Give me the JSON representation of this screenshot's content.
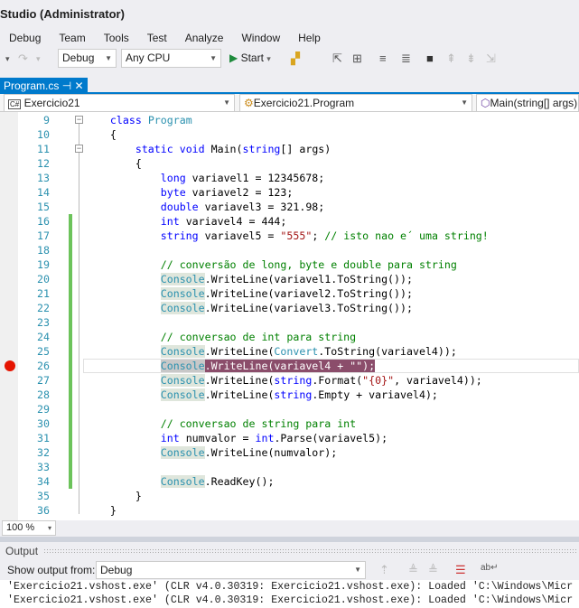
{
  "window": {
    "title": "Studio (Administrator)"
  },
  "menu": [
    "Debug",
    "Team",
    "Tools",
    "Test",
    "Analyze",
    "Window",
    "Help"
  ],
  "toolbar": {
    "configuration": "Debug",
    "platform": "Any CPU",
    "start_label": "Start"
  },
  "tab": {
    "label": "Program.cs",
    "pin": "⊣",
    "close": "✕"
  },
  "nav": {
    "project": "Exercicio21",
    "type": "Exercicio21.Program",
    "member": "Main(string[] args)",
    "project_icon": "C#"
  },
  "editor": {
    "breakpoint_line": 26,
    "lines": [
      {
        "n": "9",
        "seg": [
          [
            "    ",
            "tx"
          ],
          [
            "class",
            "kw"
          ],
          [
            " ",
            "tx"
          ],
          [
            "Program",
            "ty"
          ]
        ]
      },
      {
        "n": "10",
        "seg": [
          [
            "    {",
            "tx"
          ]
        ]
      },
      {
        "n": "11",
        "seg": [
          [
            "        ",
            "tx"
          ],
          [
            "static",
            "kw"
          ],
          [
            " ",
            "tx"
          ],
          [
            "void",
            "kw"
          ],
          [
            " Main(",
            "tx"
          ],
          [
            "string",
            "kw"
          ],
          [
            "[] args)",
            "tx"
          ]
        ]
      },
      {
        "n": "12",
        "seg": [
          [
            "        {",
            "tx"
          ]
        ]
      },
      {
        "n": "13",
        "seg": [
          [
            "            ",
            "tx"
          ],
          [
            "long",
            "kw"
          ],
          [
            " variavel1 = 12345678;",
            "tx"
          ]
        ]
      },
      {
        "n": "14",
        "seg": [
          [
            "            ",
            "tx"
          ],
          [
            "byte",
            "kw"
          ],
          [
            " variavel2 = 123;",
            "tx"
          ]
        ]
      },
      {
        "n": "15",
        "seg": [
          [
            "            ",
            "tx"
          ],
          [
            "double",
            "kw"
          ],
          [
            " variavel3 = 321.98;",
            "tx"
          ]
        ]
      },
      {
        "n": "16",
        "seg": [
          [
            "            ",
            "tx"
          ],
          [
            "int",
            "kw"
          ],
          [
            " variavel4 = 444;",
            "tx"
          ]
        ]
      },
      {
        "n": "17",
        "seg": [
          [
            "            ",
            "tx"
          ],
          [
            "string",
            "kw"
          ],
          [
            " variavel5 = ",
            "tx"
          ],
          [
            "\"555\"",
            "st"
          ],
          [
            "; ",
            "tx"
          ],
          [
            "// isto nao e´ uma string!",
            "cm"
          ]
        ]
      },
      {
        "n": "18",
        "seg": []
      },
      {
        "n": "19",
        "seg": [
          [
            "            ",
            "tx"
          ],
          [
            "// conversão de long, byte e double para string",
            "cm"
          ]
        ]
      },
      {
        "n": "20",
        "seg": [
          [
            "            ",
            "tx"
          ],
          [
            "Console",
            "ref"
          ],
          [
            ".WriteLine(variavel1.ToString());",
            "tx"
          ]
        ]
      },
      {
        "n": "21",
        "seg": [
          [
            "            ",
            "tx"
          ],
          [
            "Console",
            "ref"
          ],
          [
            ".WriteLine(variavel2.ToString());",
            "tx"
          ]
        ]
      },
      {
        "n": "22",
        "seg": [
          [
            "            ",
            "tx"
          ],
          [
            "Console",
            "ref"
          ],
          [
            ".WriteLine(variavel3.ToString());",
            "tx"
          ]
        ]
      },
      {
        "n": "23",
        "seg": []
      },
      {
        "n": "24",
        "seg": [
          [
            "            ",
            "tx"
          ],
          [
            "// conversao de int para string",
            "cm"
          ]
        ]
      },
      {
        "n": "25",
        "seg": [
          [
            "            ",
            "tx"
          ],
          [
            "Console",
            "ref"
          ],
          [
            ".WriteLine(",
            "tx"
          ],
          [
            "Convert",
            "ty"
          ],
          [
            ".ToString(variavel4));",
            "tx"
          ]
        ]
      },
      {
        "n": "26",
        "seg": [
          [
            "            ",
            "tx"
          ],
          [
            "Console",
            "selref"
          ],
          [
            ".WriteLine(variavel4 + \"\");",
            "sel"
          ]
        ]
      },
      {
        "n": "27",
        "seg": [
          [
            "            ",
            "tx"
          ],
          [
            "Console",
            "ref"
          ],
          [
            ".WriteLine(",
            "tx"
          ],
          [
            "string",
            "kw"
          ],
          [
            ".Format(",
            "tx"
          ],
          [
            "\"{0}\"",
            "st"
          ],
          [
            ", variavel4));",
            "tx"
          ]
        ]
      },
      {
        "n": "28",
        "seg": [
          [
            "            ",
            "tx"
          ],
          [
            "Console",
            "ref"
          ],
          [
            ".WriteLine(",
            "tx"
          ],
          [
            "string",
            "kw"
          ],
          [
            ".Empty + variavel4);",
            "tx"
          ]
        ]
      },
      {
        "n": "29",
        "seg": []
      },
      {
        "n": "30",
        "seg": [
          [
            "            ",
            "tx"
          ],
          [
            "// conversao de string para int",
            "cm"
          ]
        ]
      },
      {
        "n": "31",
        "seg": [
          [
            "            ",
            "tx"
          ],
          [
            "int",
            "kw"
          ],
          [
            " numvalor = ",
            "tx"
          ],
          [
            "int",
            "kw"
          ],
          [
            ".Parse(variavel5);",
            "tx"
          ]
        ]
      },
      {
        "n": "32",
        "seg": [
          [
            "            ",
            "tx"
          ],
          [
            "Console",
            "ref"
          ],
          [
            ".WriteLine(numvalor);",
            "tx"
          ]
        ]
      },
      {
        "n": "33",
        "seg": []
      },
      {
        "n": "34",
        "seg": [
          [
            "            ",
            "tx"
          ],
          [
            "Console",
            "ref"
          ],
          [
            ".ReadKey();",
            "tx"
          ]
        ]
      },
      {
        "n": "35",
        "seg": [
          [
            "        }",
            "tx"
          ]
        ]
      },
      {
        "n": "36",
        "seg": [
          [
            "    }",
            "tx"
          ]
        ]
      }
    ]
  },
  "zoom": {
    "value": "100 %"
  },
  "output": {
    "title": "Output",
    "show_from_label": "Show output from:",
    "source": "Debug",
    "lines": [
      "'Exercicio21.vshost.exe' (CLR v4.0.30319: Exercicio21.vshost.exe): Loaded 'C:\\Windows\\Micr",
      "'Exercicio21.vshost.exe' (CLR v4.0.30319: Exercicio21.vshost.exe): Loaded 'C:\\Windows\\Micr"
    ]
  },
  "colors": {
    "accent": "#007acc",
    "breakpoint": "#e51400",
    "change_bar": "#6cc35b",
    "selection": "#8b4d6b"
  }
}
